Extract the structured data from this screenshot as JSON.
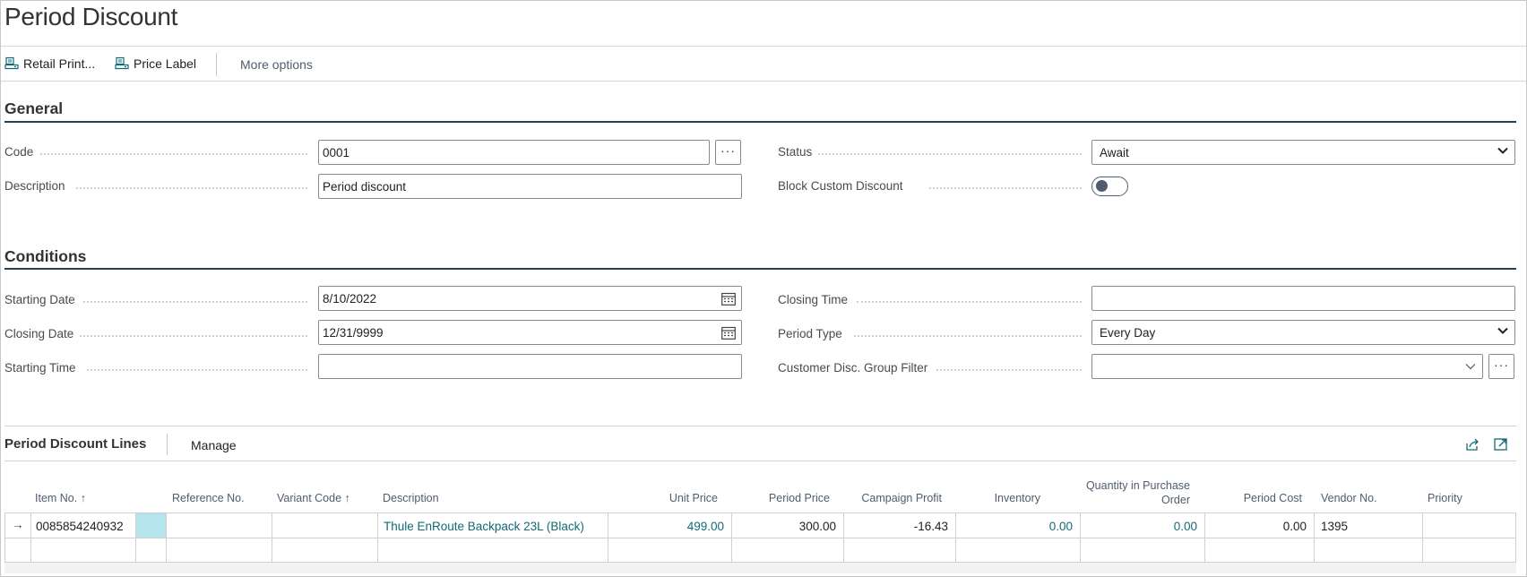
{
  "page": {
    "title": "Period Discount"
  },
  "actions": {
    "retail_print": "Retail Print...",
    "price_label": "Price Label",
    "more_options": "More options"
  },
  "general": {
    "title": "General",
    "code": {
      "label": "Code",
      "value": "0001"
    },
    "description": {
      "label": "Description",
      "value": "Period discount"
    },
    "status": {
      "label": "Status",
      "value": "Await"
    },
    "block_custom_discount": {
      "label": "Block Custom Discount",
      "enabled": false
    }
  },
  "conditions": {
    "title": "Conditions",
    "starting_date": {
      "label": "Starting Date",
      "value": "8/10/2022"
    },
    "closing_date": {
      "label": "Closing Date",
      "value": "12/31/9999"
    },
    "starting_time": {
      "label": "Starting Time",
      "value": ""
    },
    "closing_time": {
      "label": "Closing Time",
      "value": ""
    },
    "period_type": {
      "label": "Period Type",
      "value": "Every Day"
    },
    "customer_disc_group_filter": {
      "label": "Customer Disc. Group Filter",
      "value": ""
    }
  },
  "lines": {
    "title": "Period Discount Lines",
    "manage": "Manage",
    "columns": {
      "item_no": "Item No. ↑",
      "reference_no": "Reference No.",
      "variant_code": "Variant Code ↑",
      "description": "Description",
      "unit_price": "Unit Price",
      "period_price": "Period Price",
      "campaign_profit": "Campaign Profit",
      "inventory": "Inventory",
      "qty_purchase_order_1": "Quantity in Purchase",
      "qty_purchase_order_2": "Order",
      "period_cost": "Period Cost",
      "vendor_no": "Vendor No.",
      "priority": "Priority"
    },
    "rows": [
      {
        "indicator": "→",
        "item_no": "0085854240932",
        "reference_no": "",
        "variant_code": "",
        "description": "Thule EnRoute Backpack 23L (Black)",
        "unit_price": "499.00",
        "period_price": "300.00",
        "campaign_profit": "-16.43",
        "inventory": "0.00",
        "qty_purchase_order": "0.00",
        "period_cost": "0.00",
        "vendor_no": "1395",
        "priority": ""
      }
    ]
  },
  "colors": {
    "accent": "#126a77",
    "section_rule": "#26424f",
    "selected_cell": "#b6e4ec"
  },
  "icons": [
    "retail-print-icon",
    "price-label-icon",
    "ellipsis-icon",
    "chevron-down-icon",
    "calendar-icon",
    "share-icon",
    "expand-icon",
    "row-arrow-icon"
  ]
}
